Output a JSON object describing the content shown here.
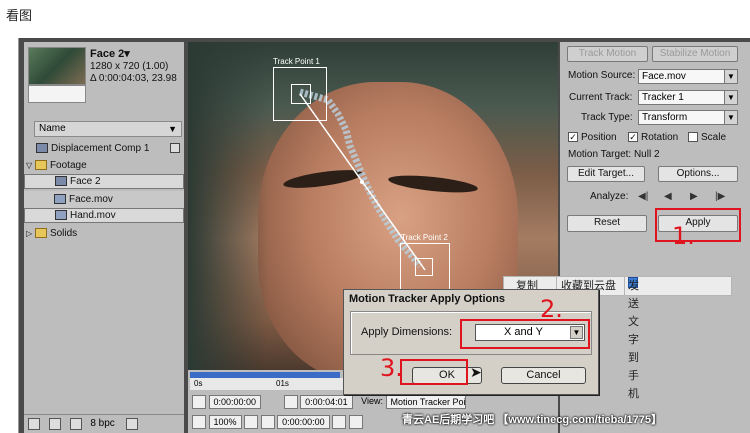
{
  "page_label": "看图",
  "project": {
    "name": "Face 2▾",
    "resolution": "1280 x 720 (1.00)",
    "duration": "Δ 0:00:04:03, 23.98",
    "column_header": "Name",
    "items": [
      {
        "label": "Displacement Comp 1",
        "icon": "comp-icon"
      },
      {
        "label": "Footage",
        "icon": "folder-icon"
      },
      {
        "label": "Face 2",
        "icon": "comp-icon"
      },
      {
        "label": "Face.mov",
        "icon": "film-icon"
      },
      {
        "label": "Hand.mov",
        "icon": "film-icon"
      },
      {
        "label": "Solids",
        "icon": "folder-icon"
      }
    ],
    "bit_depth": "8 bpc"
  },
  "video": {
    "track_point_1": "Track Point 1",
    "track_point_2": "Track Point 2"
  },
  "timeline": {
    "tick_0": "0s",
    "tick_1": "01s",
    "timecode_left": "0:00:00:00",
    "timecode_mid": "0:00:04:01",
    "timecode_right": "0:00:00:00",
    "view_label": "View:",
    "view_value": "Motion Tracker Poin",
    "zoom": "100%"
  },
  "tracker": {
    "track_motion": "Track Motion",
    "stabilize_motion": "Stabilize Motion",
    "motion_source_label": "Motion Source:",
    "motion_source": "Face.mov",
    "current_track_label": "Current Track:",
    "current_track": "Tracker 1",
    "track_type_label": "Track Type:",
    "track_type": "Transform",
    "position": "Position",
    "rotation": "Rotation",
    "scale": "Scale",
    "motion_target": "Motion Target: Null 2",
    "edit_target": "Edit Target...",
    "options": "Options...",
    "analyze": "Analyze:",
    "reset": "Reset",
    "apply": "Apply"
  },
  "context_menu": {
    "copy": "复制",
    "save_cloud": "收藏到云盘",
    "send_phone": "发送文字到手机"
  },
  "dialog": {
    "title": "Motion Tracker Apply Options",
    "dimensions_label": "Apply Dimensions:",
    "dimensions_value": "X and Y",
    "ok": "OK",
    "cancel": "Cancel"
  },
  "annotations": {
    "step1": "1.",
    "step2": "2.",
    "step3": "3."
  },
  "watermark": "青云AE后期学习吧 【www.tinecg.com/tieba/1775】",
  "colors": {
    "annotation_red": "#e0141e",
    "panel_gray": "#bdbdbd",
    "selection_blue": "#3a6bc6"
  }
}
